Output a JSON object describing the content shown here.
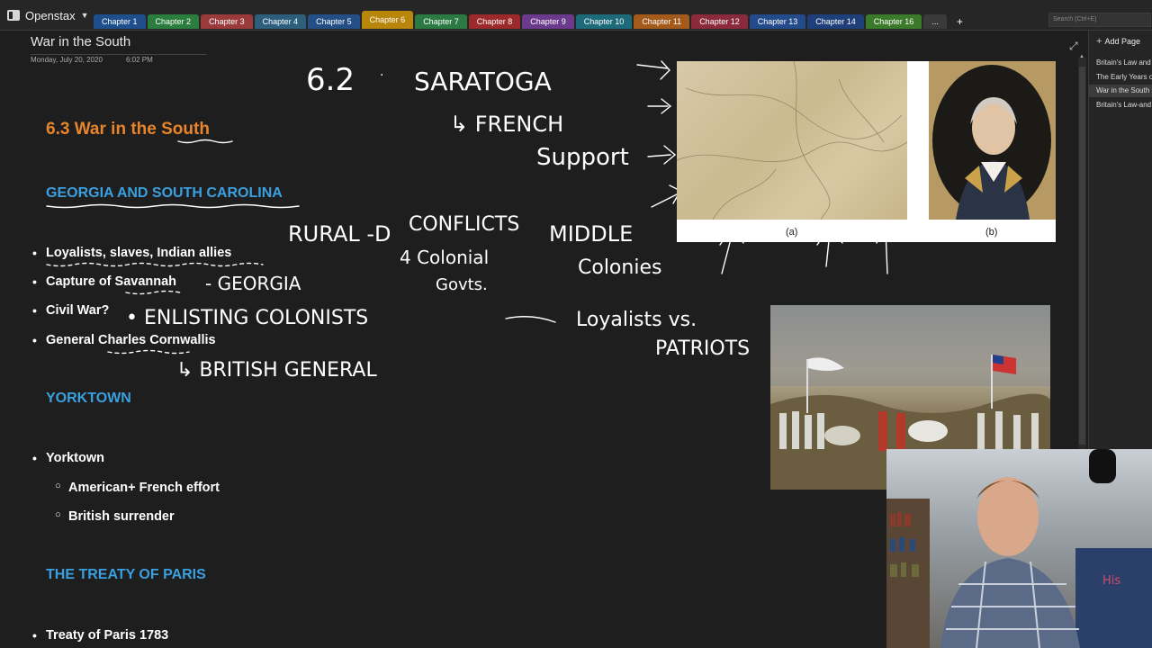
{
  "app": {
    "notebook_name": "Openstax",
    "search_placeholder": "Search (Ctrl+E)"
  },
  "tabs": [
    {
      "label": "Chapter 1",
      "color": "#1f4e8c"
    },
    {
      "label": "Chapter 2",
      "color": "#2a7d3c"
    },
    {
      "label": "Chapter 3",
      "color": "#9a3a3a"
    },
    {
      "label": "Chapter 4",
      "color": "#2d5f7d"
    },
    {
      "label": "Chapter 5",
      "color": "#244f86"
    },
    {
      "label": "Chapter 6",
      "color": "#b8860b",
      "active": true
    },
    {
      "label": "Chapter 7",
      "color": "#2b7a43"
    },
    {
      "label": "Chapter 8",
      "color": "#9c2a2a"
    },
    {
      "label": "Chapter 9",
      "color": "#6b3a8c"
    },
    {
      "label": "Chapter 10",
      "color": "#1d6a7a"
    },
    {
      "label": "Chapter 11",
      "color": "#a35a1a"
    },
    {
      "label": "Chapter 12",
      "color": "#8a2a3a"
    },
    {
      "label": "Chapter 13",
      "color": "#234a8a"
    },
    {
      "label": "Chapter 14",
      "color": "#1e3f7a"
    },
    {
      "label": "Chapter 16",
      "color": "#3b7a2a"
    }
  ],
  "tabs_more_label": "...",
  "tabs_add_label": "+",
  "page": {
    "title": "War in the South",
    "date": "Monday, July 20, 2020",
    "time": "6:02 PM"
  },
  "notes": {
    "heading": "6.3 War in the South",
    "section1": "GEORGIA AND SOUTH CAROLINA",
    "bullets1": [
      "Loyalists, slaves, Indian allies",
      "Capture of Savannah",
      "Civil War?",
      "General Charles Cornwallis"
    ],
    "section2": "YORKTOWN",
    "bullets2": [
      "Yorktown"
    ],
    "subbullets2": [
      "American+ French effort",
      "British surrender"
    ],
    "section3": "THE TREATY OF PARIS",
    "bullets3": [
      "Treaty of Paris 1783"
    ]
  },
  "ink": {
    "saratoga_num": "6.2",
    "saratoga": "SARATOGA",
    "french": "↳ FRENCH",
    "support": "Support",
    "rural": "RURAL -D",
    "conflicts": "CONFLICTS",
    "colonial": "4 Colonial",
    "govts": "Govts.",
    "middle": "MIDDLE",
    "colonies": "Colonies",
    "georgia": "- GEORGIA",
    "enlisting": "•  ENLISTING  COLONISTS",
    "british_general": "↳ BRITISH  GENERAL",
    "loyalists": "Loyalists  vs.",
    "patriots": "PATRIOTS"
  },
  "figures": {
    "caption_a": "(a)",
    "caption_b": "(b)"
  },
  "pages_panel": {
    "add_page_label": "Add Page",
    "pages": [
      {
        "label": "Britain's Law and",
        "selected": false
      },
      {
        "label": "The Early Years o",
        "selected": false
      },
      {
        "label": "War in the South",
        "selected": true
      },
      {
        "label": "Britain's Law-and",
        "selected": false
      }
    ]
  }
}
